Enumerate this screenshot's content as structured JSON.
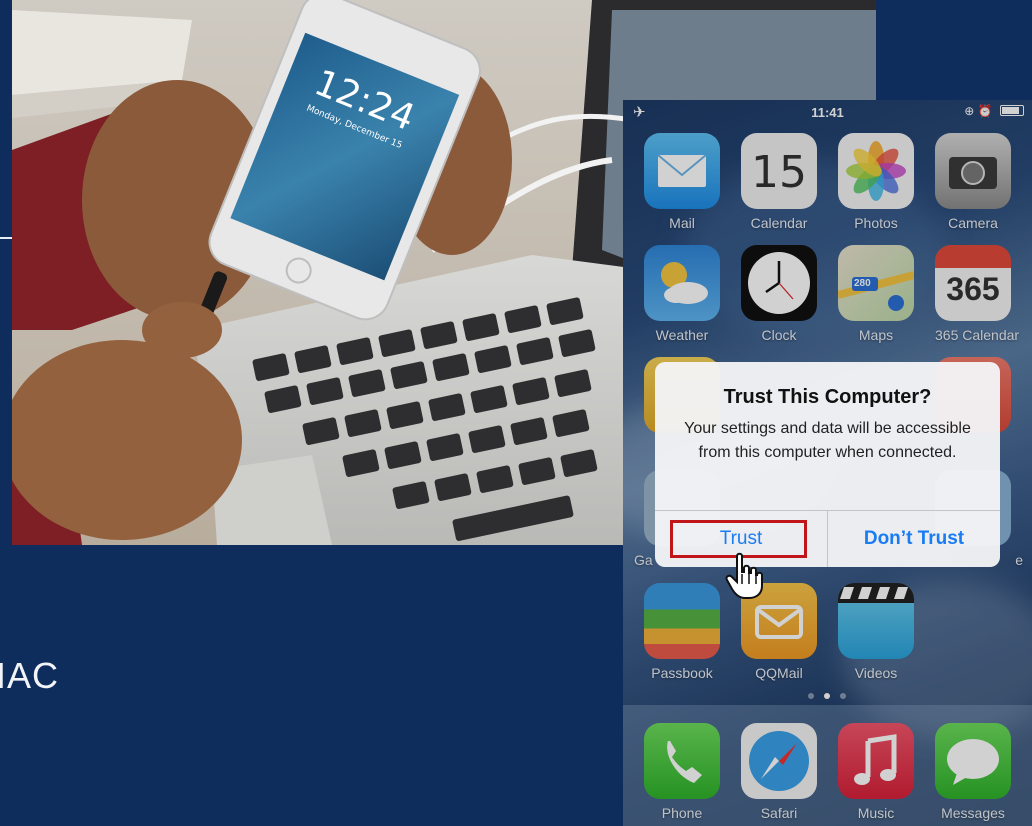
{
  "slide": {
    "caption_fragment": "IAC"
  },
  "lockscreen": {
    "time": "12:24",
    "date": "Monday, December 15"
  },
  "phone": {
    "status": {
      "time": "11:41"
    },
    "apps": [
      {
        "label": "Mail",
        "icon": "mail-icon"
      },
      {
        "label": "Calendar",
        "icon": "calendar-icon",
        "badge_text": "15"
      },
      {
        "label": "Photos",
        "icon": "photos-icon"
      },
      {
        "label": "Camera",
        "icon": "camera-icon"
      },
      {
        "label": "Weather",
        "icon": "weather-icon"
      },
      {
        "label": "Clock",
        "icon": "clock-icon"
      },
      {
        "label": "Maps",
        "icon": "maps-icon",
        "badge_text": "280"
      },
      {
        "label": "365 Calendar",
        "icon": "calendar-365-icon",
        "badge_text": "365"
      },
      {
        "label": "Ga",
        "icon": "game-center-icon"
      },
      {
        "label": "e",
        "icon": "app-icon"
      },
      {
        "label": "Passbook",
        "icon": "passbook-icon"
      },
      {
        "label": "QQMail",
        "icon": "qqmail-icon"
      },
      {
        "label": "Videos",
        "icon": "videos-icon"
      }
    ],
    "dock": [
      {
        "label": "Phone",
        "icon": "phone-icon"
      },
      {
        "label": "Safari",
        "icon": "safari-icon"
      },
      {
        "label": "Music",
        "icon": "music-icon"
      },
      {
        "label": "Messages",
        "icon": "messages-icon"
      }
    ],
    "page_dots": 3,
    "active_page": 1
  },
  "dialog": {
    "title": "Trust This Computer?",
    "message": "Your settings and data will be accessible from this computer when connected.",
    "trust_label": "Trust",
    "dont_trust_label": "Don’t Trust"
  },
  "colors": {
    "background": "#0e2d5c",
    "accent_blue": "#1a7cf2",
    "highlight_red": "#c0161a"
  }
}
